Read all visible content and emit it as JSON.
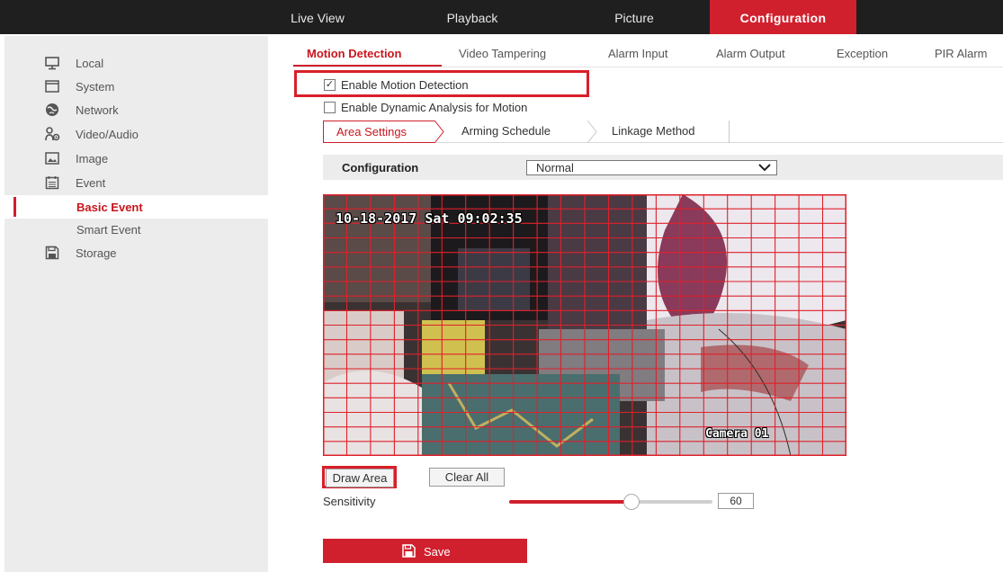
{
  "topnav": [
    "Live View",
    "Playback",
    "Picture",
    "Configuration"
  ],
  "sidebar": {
    "items": [
      {
        "label": "Local",
        "icon": "monitor-icon"
      },
      {
        "label": "System",
        "icon": "system-icon"
      },
      {
        "label": "Network",
        "icon": "network-globe-icon"
      },
      {
        "label": "Video/Audio",
        "icon": "video-audio-icon"
      },
      {
        "label": "Image",
        "icon": "image-icon"
      },
      {
        "label": "Event",
        "icon": "event-calendar-icon"
      }
    ],
    "sub_items": [
      "Basic Event",
      "Smart Event"
    ],
    "storage": {
      "label": "Storage",
      "icon": "storage-icon"
    }
  },
  "tabs": [
    "Motion Detection",
    "Video Tampering",
    "Alarm Input",
    "Alarm Output",
    "Exception",
    "PIR Alarm"
  ],
  "active_tab": "Motion Detection",
  "enable_motion": {
    "label": "Enable Motion Detection",
    "checked": true
  },
  "enable_dynamic": {
    "label": "Enable Dynamic Analysis for Motion",
    "checked": false
  },
  "subtabs": [
    "Area Settings",
    "Arming Schedule",
    "Linkage Method"
  ],
  "config": {
    "label": "Configuration",
    "value": "Normal"
  },
  "video": {
    "timestamp": "10-18-2017 Sat 09:02:35",
    "camera_name": "Camera 01"
  },
  "buttons": {
    "draw_area": "Draw Area",
    "clear_all": "Clear All",
    "save": "Save"
  },
  "sensitivity": {
    "label": "Sensitivity",
    "value": "60",
    "level": 0.6
  },
  "colors": {
    "accent": "#d0202d",
    "topbar": "#1f1f1f",
    "sidebar": "#ececec"
  }
}
